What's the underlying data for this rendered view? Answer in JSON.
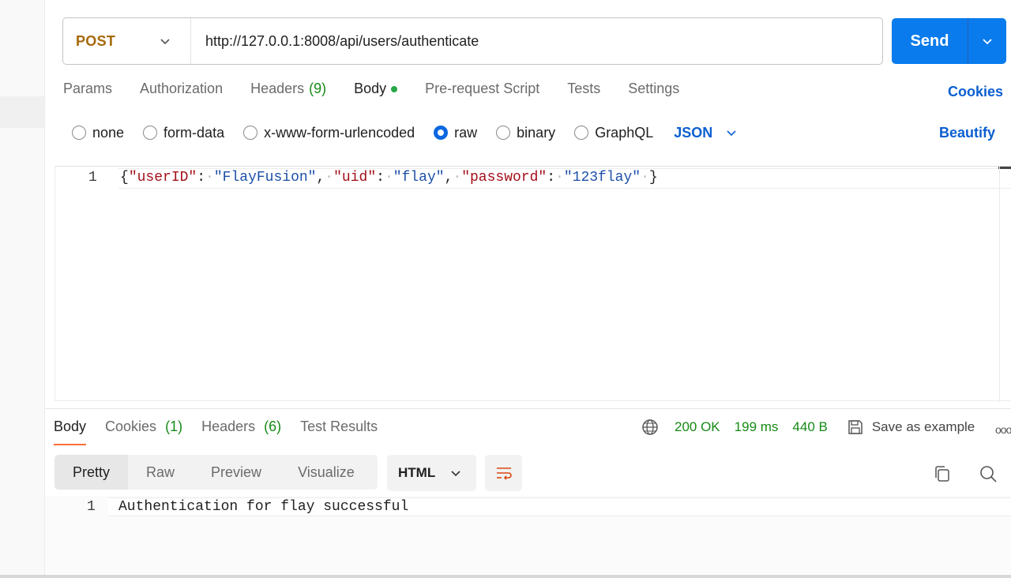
{
  "request": {
    "method": "POST",
    "url": "http://127.0.0.1:8008/api/users/authenticate",
    "send_label": "Send"
  },
  "request_tabs": [
    {
      "label": "Params",
      "count": "",
      "active": false
    },
    {
      "label": "Authorization",
      "count": "",
      "active": false
    },
    {
      "label": "Headers",
      "count": "(9)",
      "active": false
    },
    {
      "label": "Body",
      "count": "",
      "active": true,
      "indicator": "green-dot"
    },
    {
      "label": "Pre-request Script",
      "count": "",
      "active": false
    },
    {
      "label": "Tests",
      "count": "",
      "active": false
    },
    {
      "label": "Settings",
      "count": "",
      "active": false
    }
  ],
  "cookies_link": "Cookies",
  "body_types": [
    {
      "label": "none",
      "selected": false
    },
    {
      "label": "form-data",
      "selected": false
    },
    {
      "label": "x-www-form-urlencoded",
      "selected": false
    },
    {
      "label": "raw",
      "selected": true
    },
    {
      "label": "binary",
      "selected": false
    },
    {
      "label": "GraphQL",
      "selected": false
    }
  ],
  "raw_type": "JSON",
  "beautify_label": "Beautify",
  "editor": {
    "line_number": "1",
    "code": {
      "open": "{",
      "k1": "\"userID\"",
      "v1": "\"FlayFusion\"",
      "k2": "\"uid\"",
      "v2": "\"flay\"",
      "k3": "\"password\"",
      "v3": "\"123flay\"",
      "close": "}"
    }
  },
  "response_tabs": [
    {
      "label": "Body",
      "count": "",
      "active": true
    },
    {
      "label": "Cookies",
      "count": "(1)",
      "active": false
    },
    {
      "label": "Headers",
      "count": "(6)",
      "active": false
    },
    {
      "label": "Test Results",
      "count": "",
      "active": false
    }
  ],
  "response_meta": {
    "status": "200 OK",
    "time": "199 ms",
    "size": "440 B",
    "save_label": "Save as example",
    "more": "ooo"
  },
  "view_modes": [
    {
      "label": "Pretty",
      "active": true
    },
    {
      "label": "Raw",
      "active": false
    },
    {
      "label": "Preview",
      "active": false
    },
    {
      "label": "Visualize",
      "active": false
    }
  ],
  "response_format": "HTML",
  "response_body": {
    "line_number": "1",
    "text": "Authentication for flay successful"
  },
  "colors": {
    "method": "#a6680b",
    "send": "#097bed",
    "link": "#0b5fd1",
    "status_green": "#168a16",
    "active_tab_underline": "#ff6c37",
    "json_key": "#a3101a",
    "json_string": "#1c4fa8"
  },
  "icons": [
    "chevron-down-icon",
    "globe-icon",
    "save-icon",
    "wrap-lines-icon",
    "copy-icon",
    "search-icon"
  ]
}
